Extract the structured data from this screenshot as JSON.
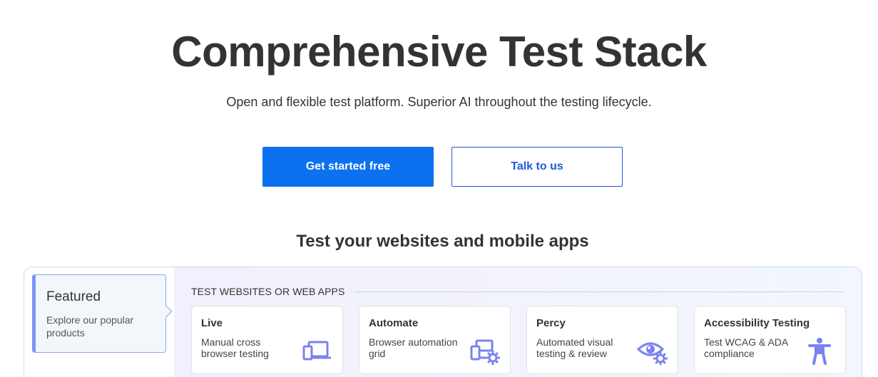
{
  "hero": {
    "title": "Comprehensive Test Stack",
    "subtitle": "Open and flexible test platform. Superior AI throughout the testing lifecycle."
  },
  "cta": {
    "primary_label": "Get started free",
    "secondary_label": "Talk to us"
  },
  "section": {
    "title": "Test your websites and mobile apps"
  },
  "featured": {
    "title": "Featured",
    "description": "Explore our popular products"
  },
  "group": {
    "label": "TEST WEBSITES OR WEB APPS"
  },
  "cards": [
    {
      "title": "Live",
      "description": "Manual cross browser testing",
      "icon": "devices-icon"
    },
    {
      "title": "Automate",
      "description": "Browser automation grid",
      "icon": "devices-gear-icon"
    },
    {
      "title": "Percy",
      "description": "Automated visual testing & review",
      "icon": "eye-gear-icon"
    },
    {
      "title": "Accessibility Testing",
      "description": "Test WCAG & ADA compliance",
      "icon": "accessibility-icon"
    }
  ],
  "colors": {
    "primary": "#0c71ee",
    "secondary_text": "#1f5bd6",
    "icon_accent": "#7a83f0",
    "featured_border": "#7a96f5"
  }
}
